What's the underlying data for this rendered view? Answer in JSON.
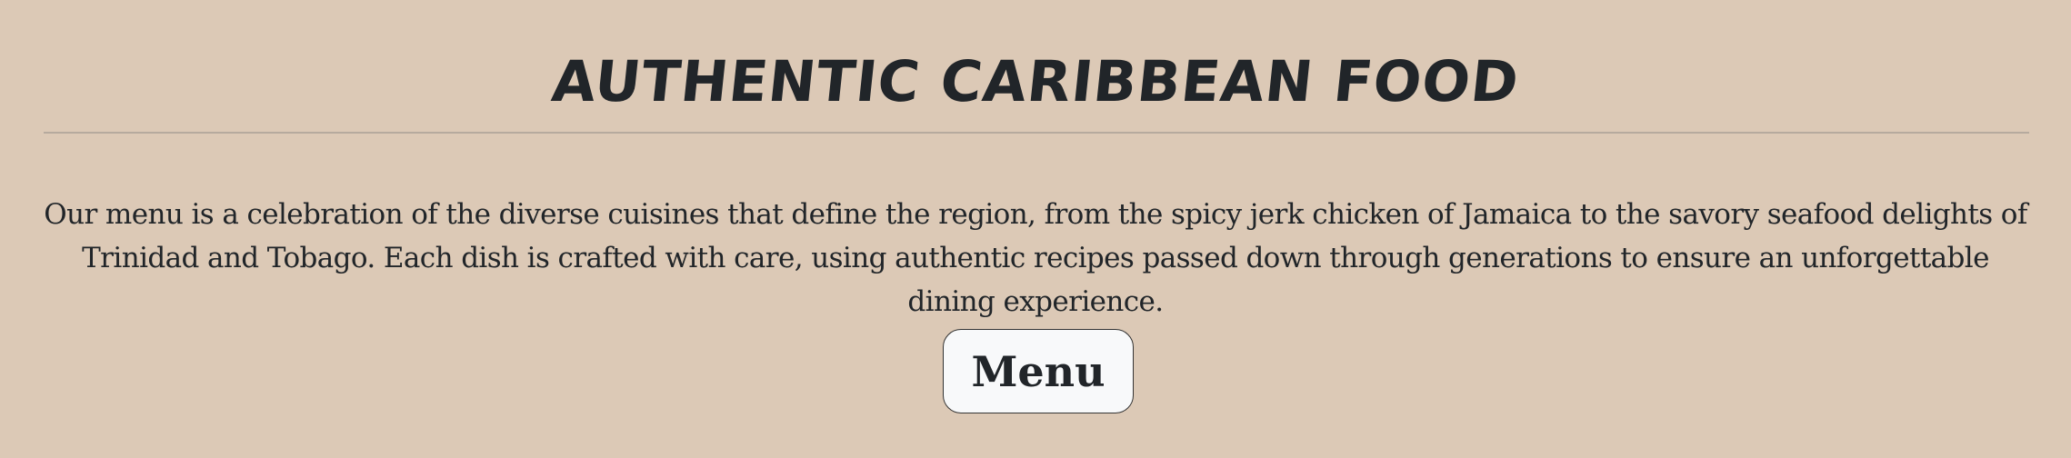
{
  "section": {
    "title": "AUTHENTIC CARIBBEAN FOOD",
    "description": "Our menu is a celebration of the diverse cuisines that define the region, from the spicy jerk chicken of Jamaica to the savory seafood delights of Trinidad and Tobago. Each dish is crafted with care, using authentic recipes passed down through generations to ensure an unforgettable dining experience.",
    "button_label": "Menu"
  },
  "colors": {
    "background": "#dcc9b6",
    "text": "#212529",
    "button_background": "#f8f9fa",
    "divider": "#b6aa9e"
  }
}
